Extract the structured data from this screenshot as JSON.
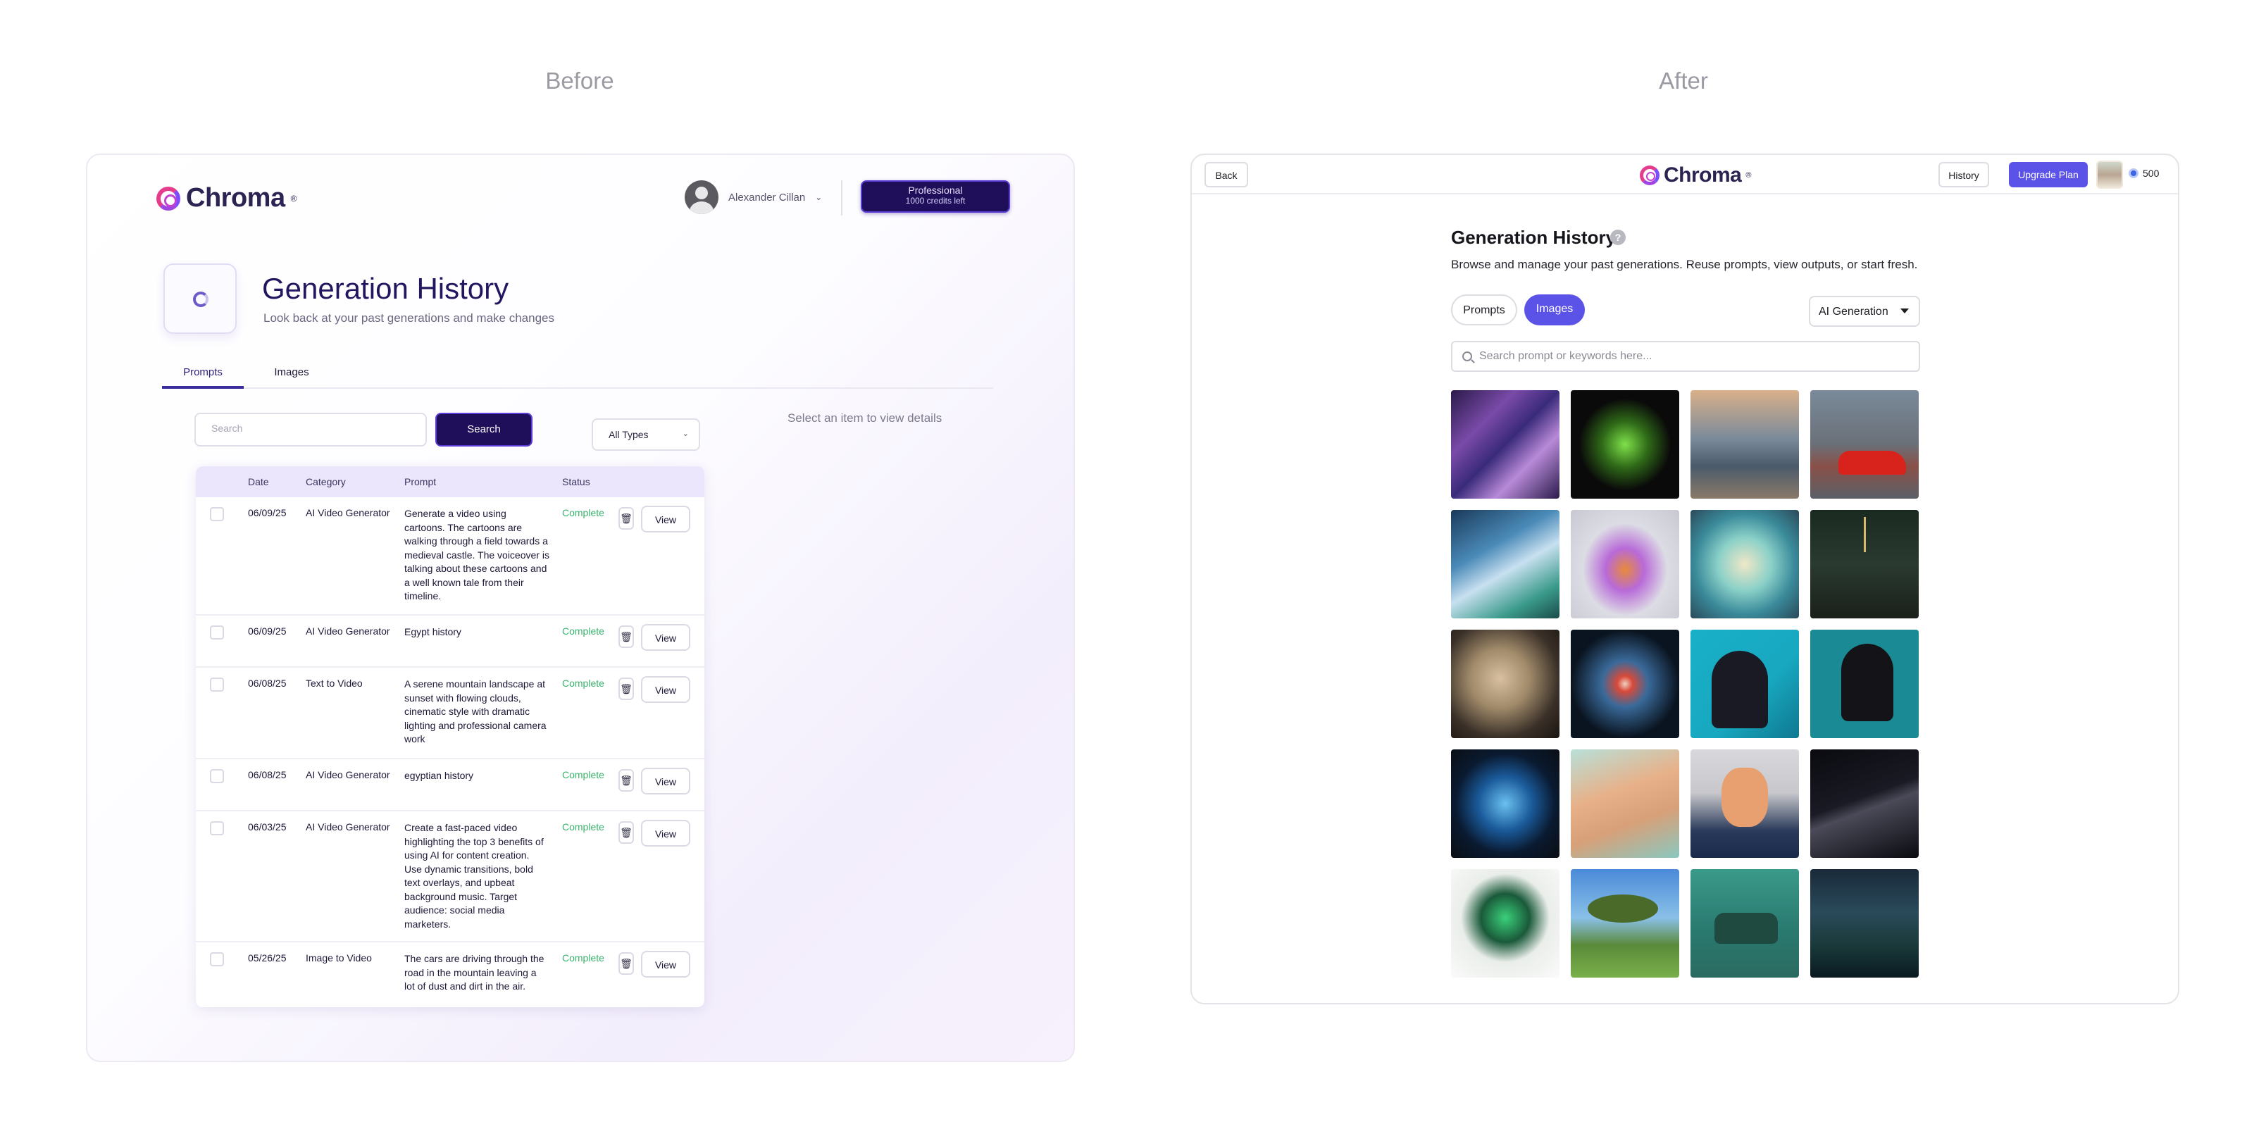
{
  "captions": {
    "before": "Before",
    "after": "After"
  },
  "before": {
    "logo": {
      "brand": "Chroma",
      "mark": "®"
    },
    "user": {
      "name": "Alexander Cillan"
    },
    "plan": {
      "name": "Professional",
      "credits": "1000 credits left"
    },
    "header": {
      "title": "Generation History",
      "subtitle": "Look back at your past generations and make changes"
    },
    "tabs": [
      {
        "label": "Prompts",
        "active": true
      },
      {
        "label": "Images",
        "active": false
      }
    ],
    "search": {
      "placeholder": "Search",
      "button": "Search"
    },
    "filter": {
      "selected": "All Types"
    },
    "details_hint": "Select an item to view details",
    "table": {
      "columns": [
        "Date",
        "Category",
        "Prompt",
        "Status"
      ],
      "rows": [
        {
          "date": "06/09/25",
          "category": "AI Video Generator",
          "prompt": "Generate a video using cartoons. The cartoons are walking through a field towards a medieval castle. The voiceover is talking about these cartoons and a well known tale from their timeline.",
          "status": "Complete",
          "action": "View"
        },
        {
          "date": "06/09/25",
          "category": "AI Video Generator",
          "prompt": "Egypt history",
          "status": "Complete",
          "action": "View"
        },
        {
          "date": "06/08/25",
          "category": "Text to Video",
          "prompt": "A serene mountain landscape at sunset with flowing clouds, cinematic style with dramatic lighting and professional camera work",
          "status": "Complete",
          "action": "View"
        },
        {
          "date": "06/08/25",
          "category": "AI Video Generator",
          "prompt": "egyptian history",
          "status": "Complete",
          "action": "View"
        },
        {
          "date": "06/03/25",
          "category": "AI Video Generator",
          "prompt": "Create a fast-paced video highlighting the top 3 benefits of using AI for content creation. Use dynamic transitions, bold text overlays, and upbeat background music. Target audience: social media marketers.",
          "status": "Complete",
          "action": "View"
        },
        {
          "date": "05/26/25",
          "category": "Image to Video",
          "prompt": "The cars are driving through the road in the mountain leaving a lot of dust and dirt in the air.",
          "status": "Complete",
          "action": "View"
        }
      ]
    },
    "colors": {
      "accent": "#1f0f5a",
      "status_complete": "#39b26c",
      "header_bg": "#ebe6fb"
    }
  },
  "after": {
    "topbar": {
      "back": "Back",
      "brand": "Chroma",
      "mark": "®",
      "history": "History",
      "upgrade": "Upgrade Plan",
      "credits": "500"
    },
    "header": {
      "title": "Generation History",
      "help": "?",
      "subtitle": "Browse and manage your past generations. Reuse prompts, view outputs, or start fresh."
    },
    "tabs": [
      {
        "label": "Prompts",
        "active": false
      },
      {
        "label": "Images",
        "active": true
      }
    ],
    "dropdown": {
      "selected": "AI Generation"
    },
    "search": {
      "placeholder": "Search prompt or keywords here..."
    },
    "gallery_count": 20,
    "colors": {
      "accent": "#5b52e8"
    }
  }
}
